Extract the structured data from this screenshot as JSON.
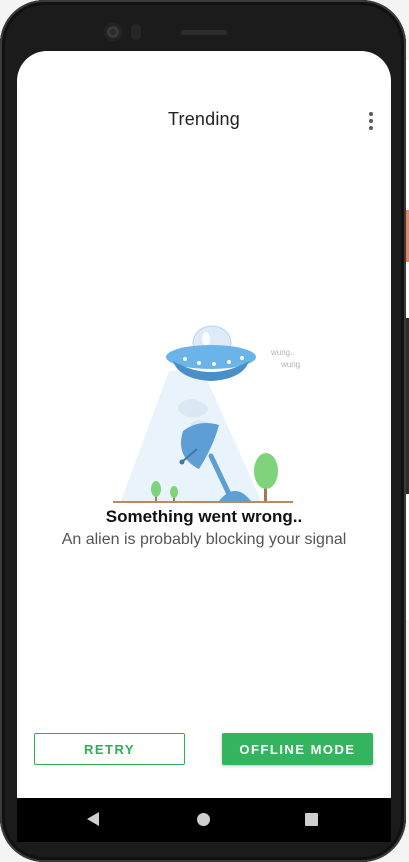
{
  "app_bar": {
    "title": "Trending",
    "menu_icon": "more-vertical-icon"
  },
  "illustration": {
    "name": "ufo-abducting-satellite-dish",
    "caption_1": "wung..",
    "caption_2": "wung.."
  },
  "error": {
    "title": "Something went wrong..",
    "subtitle": "An alien is probably blocking your signal"
  },
  "actions": {
    "retry_label": "RETRY",
    "offline_label": "OFFLINE MODE"
  },
  "system_nav": {
    "back_icon": "back-triangle-icon",
    "home_icon": "home-circle-icon",
    "recents_icon": "recents-square-icon"
  },
  "colors": {
    "accent_green": "#34b45e",
    "ufo_blue": "#6ab4ea",
    "tree_green": "#7fd37a"
  }
}
